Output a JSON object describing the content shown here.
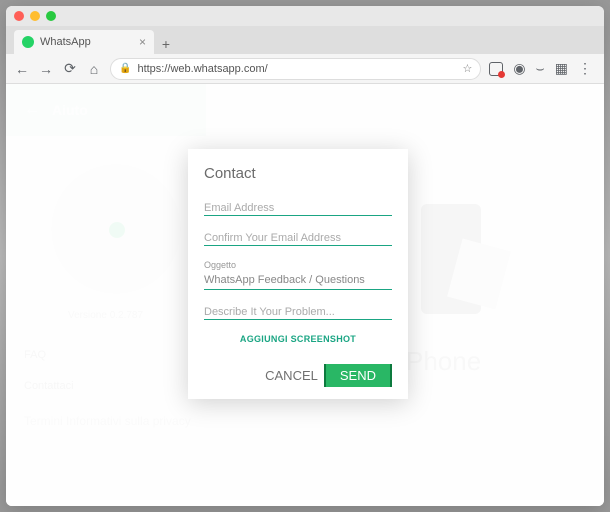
{
  "tab": {
    "title": "WhatsApp"
  },
  "url": "https://web.whatsapp.com/",
  "background": {
    "header_label": "Aiuto",
    "version": "Versione 0.2.787",
    "faq": "FAQ",
    "contact": "Contattaci",
    "terms": "Termini Informativi sulla privacy",
    "phone_word": "Phone"
  },
  "modal": {
    "title": "Contact",
    "email_placeholder": "Email Address",
    "confirm_placeholder": "Confirm Your Email Address",
    "subject_label": "Oggetto",
    "subject_value": "WhatsApp Feedback / Questions",
    "describe_placeholder": "Describe It Your Problem...",
    "attach_label": "AGGIUNGI SCREENSHOT",
    "cancel_label": "CANCEL",
    "send_label": "SEND"
  }
}
